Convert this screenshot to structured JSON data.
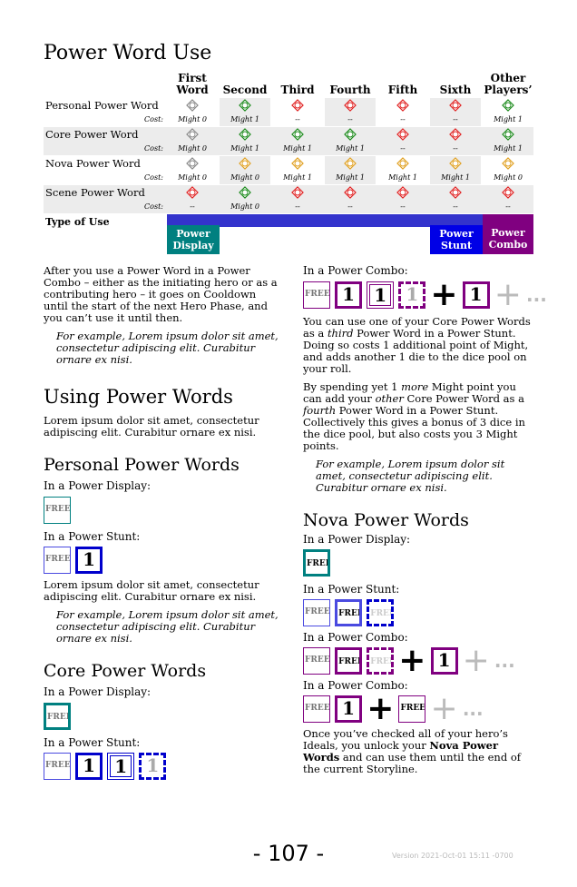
{
  "title": "Power Word Use",
  "table": {
    "columns": [
      "First Word",
      "Second",
      "Third",
      "Fourth",
      "Fifth",
      "Sixth",
      "Other Players’"
    ],
    "cost_label": "Cost:",
    "rows": [
      {
        "name": "Personal Power Word",
        "icons": [
          "gray",
          "green",
          "red",
          "red",
          "red",
          "red",
          "green"
        ],
        "costs": [
          "Might 0",
          "Might 1",
          "--",
          "--",
          "--",
          "--",
          "Might 1"
        ]
      },
      {
        "name": "Core Power Word",
        "icons": [
          "gray",
          "green",
          "green",
          "green",
          "red",
          "red",
          "green"
        ],
        "costs": [
          "Might 0",
          "Might 1",
          "Might 1",
          "Might 1",
          "--",
          "--",
          "Might 1"
        ]
      },
      {
        "name": "Nova Power Word",
        "icons": [
          "gray",
          "yellow",
          "yellow",
          "yellow",
          "yellow",
          "yellow",
          "yellow"
        ],
        "costs": [
          "Might 0",
          "Might 0",
          "Might 1",
          "Might 1",
          "Might 1",
          "Might 1",
          "Might 0"
        ]
      },
      {
        "name": "Scene Power Word",
        "icons": [
          "red",
          "green",
          "red",
          "red",
          "red",
          "red",
          "red"
        ],
        "costs": [
          "--",
          "Might 0",
          "--",
          "--",
          "--",
          "--",
          "--"
        ]
      }
    ],
    "type_of_use": "Type of Use",
    "types": {
      "display": "Power Display",
      "stunt": "Power Stunt",
      "combo": "Power Combo"
    },
    "colors": {
      "display": "#008080",
      "stunt": "#0000e6",
      "combo": "#800080",
      "band": "#3333cc",
      "shade": "#ececec"
    }
  },
  "left": {
    "intro": "After you use a Power Word in a Power Combo – either as the initiating hero or as a contributing hero – it goes on Cooldown until the start of the next Hero Phase, and you can’t use it until then.",
    "intro_example": "For example, Lorem ipsum dolor sit amet, consectetur adipiscing elit. Curabitur ornare ex nisi.",
    "using_heading": "Using Power Words",
    "using_text": "Lorem ipsum dolor sit amet, consectetur adipiscing elit. Curabitur ornare ex nisi.",
    "personal_heading": "Personal Power Words",
    "in_display": "In a Power Display:",
    "in_stunt": "In a Power Stunt:",
    "personal_text": "Lorem ipsum dolor sit amet, consectetur adipiscing elit. Curabitur ornare ex nisi.",
    "personal_example": "For example, Lorem ipsum dolor sit amet, consectetur adipiscing elit. Curabitur ornare ex nisi.",
    "core_heading": "Core Power Words",
    "core_display": "In a Power Display:",
    "core_stunt": "In a Power Stunt:"
  },
  "right": {
    "combo_label": "In a Power Combo:",
    "p1_a": "You can use one of your Core Power Words as a ",
    "p1_em": "third",
    "p1_b": " Power Word in a Power Stunt. Doing so costs 1 additional point of Might, and adds another 1 die to the dice pool on your roll.",
    "p2_a": "By spending yet 1 ",
    "p2_em1": "more",
    "p2_b": " Might point you can add your ",
    "p2_em2": "other",
    "p2_c": " Core Power Word as a ",
    "p2_em3": "fourth",
    "p2_d": " Power Word in a Power Stunt. Collectively this gives a bonus of 3 dice in the dice pool, but also costs you 3 Might points.",
    "example": "For example, Lorem ipsum dolor sit amet, consectetur adipiscing elit. Curabitur ornare ex nisi.",
    "nova_heading": "Nova Power Words",
    "nova_display": "In a Power Display:",
    "nova_stunt": "In a Power Stunt:",
    "nova_combo1": "In a Power Combo:",
    "nova_combo2": "In a Power Combo:",
    "final_a": "Once you’ve checked all of your hero’s Ideals, you unlock your ",
    "final_b": "Nova Power Words",
    "final_c": " and can use them until the end of the current Storyline."
  },
  "chips": {
    "free": "FREE",
    "one": "1",
    "plus": "+",
    "ellipsis": "..."
  },
  "page_number": "- 107 -",
  "version": "Version 2021-Oct-01 15:11 -0700"
}
